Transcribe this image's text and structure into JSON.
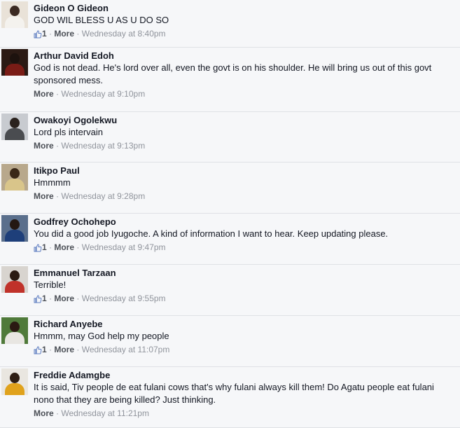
{
  "comments": [
    {
      "author": "Gideon O Gideon",
      "text": "GOD WIL BLESS U AS U DO SO",
      "likes": "1",
      "more": "More",
      "time": "Wednesday at 8:40pm",
      "avatar_colors": {
        "bg": "#e9e2d8",
        "head": "#3b2a22",
        "body": "#f4f2ee"
      }
    },
    {
      "author": "Arthur David Edoh",
      "text": "God is not dead. He's lord over all, even the govt is on his shoulder. He will bring us out of this govt sponsored mess.",
      "likes": "",
      "more": "More",
      "time": "Wednesday at 9:10pm",
      "avatar_colors": {
        "bg": "#2b1a14",
        "head": "#1d120e",
        "body": "#7a1c16"
      }
    },
    {
      "author": "Owakoyi Ogolekwu",
      "text": "Lord pls intervain",
      "likes": "",
      "more": "More",
      "time": "Wednesday at 9:13pm",
      "avatar_colors": {
        "bg": "#c8cbd0",
        "head": "#2a221e",
        "body": "#4a4c50"
      }
    },
    {
      "author": "Itikpo Paul",
      "text": "Hmmmm",
      "likes": "",
      "more": "More",
      "time": "Wednesday at 9:28pm",
      "avatar_colors": {
        "bg": "#b8a88c",
        "head": "#3a2818",
        "body": "#d9c58a"
      }
    },
    {
      "author": "Godfrey Ochohepo",
      "text": "You did a good job Iyugoche. A kind of information I want to hear. Keep updating please.",
      "likes": "1",
      "more": "More",
      "time": "Wednesday at 9:47pm",
      "avatar_colors": {
        "bg": "#5a6f8c",
        "head": "#241812",
        "body": "#1e3f7a"
      }
    },
    {
      "author": "Emmanuel Tarzaan",
      "text": "Terrible!",
      "likes": "1",
      "more": "More",
      "time": "Wednesday at 9:55pm",
      "avatar_colors": {
        "bg": "#d8d4cf",
        "head": "#2a1a12",
        "body": "#c0322a"
      }
    },
    {
      "author": "Richard Anyebe",
      "text": "Hmmm, may God help my people",
      "likes": "1",
      "more": "More",
      "time": "Wednesday at 11:07pm",
      "avatar_colors": {
        "bg": "#4f7a3a",
        "head": "#2a1a12",
        "body": "#e8e6e2"
      }
    },
    {
      "author": "Freddie Adamgbe",
      "text": "It is said, Tiv people de eat fulani cows that's why fulani always kill them! Do Agatu people eat fulani nono that they are being killed? Just thinking.",
      "likes": "",
      "more": "More",
      "time": "Wednesday at 11:21pm",
      "avatar_colors": {
        "bg": "#e9e6e0",
        "head": "#2e1e14",
        "body": "#e0a21c"
      }
    }
  ]
}
